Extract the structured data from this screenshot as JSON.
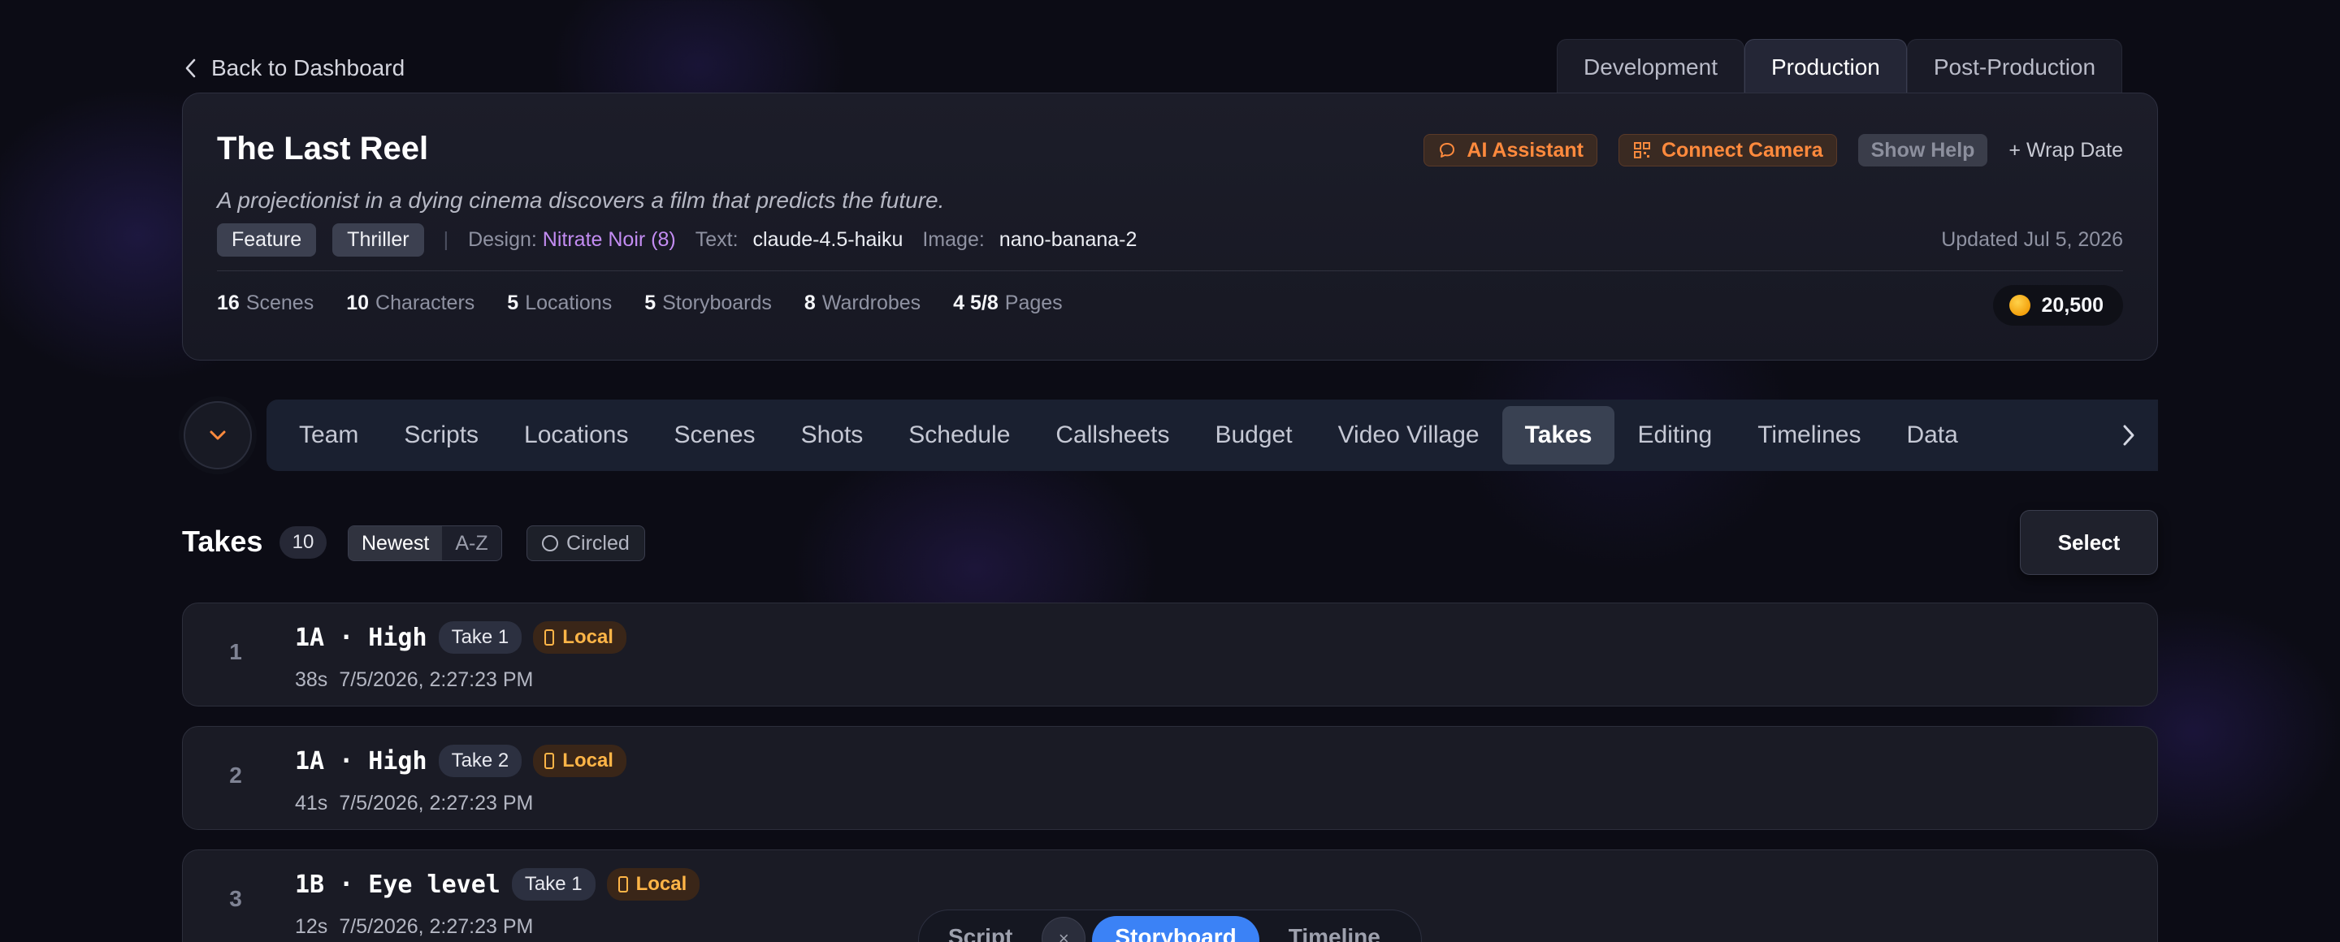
{
  "header": {
    "back_label": "Back to Dashboard",
    "phases": [
      {
        "label": "Development",
        "active": false
      },
      {
        "label": "Production",
        "active": true
      },
      {
        "label": "Post-Production",
        "active": false
      }
    ]
  },
  "project": {
    "title": "The Last Reel",
    "logline": "A projectionist in a dying cinema discovers a film that predicts the future.",
    "tags": [
      "Feature",
      "Thriller"
    ],
    "design_label": "Design:",
    "design_value": "Nitrate Noir (8)",
    "text_label": "Text:",
    "text_value": "claude-4.5-haiku",
    "image_label": "Image:",
    "image_value": "nano-banana-2",
    "updated": "Updated Jul 5, 2026",
    "actions": {
      "ai_assistant": "AI Assistant",
      "connect_camera": "Connect Camera",
      "show_help": "Show Help",
      "wrap_date": "+ Wrap Date"
    },
    "stats": [
      {
        "value": "16",
        "label": "Scenes"
      },
      {
        "value": "10",
        "label": "Characters"
      },
      {
        "value": "5",
        "label": "Locations"
      },
      {
        "value": "5",
        "label": "Storyboards"
      },
      {
        "value": "8",
        "label": "Wardrobes"
      },
      {
        "value": "4 5/8",
        "label": "Pages"
      }
    ],
    "credits": "20,500",
    "colors": {
      "accent_orange": "#ff8a3d",
      "design_purple": "#c38cf2",
      "coin": "#f3a10d"
    }
  },
  "nav": {
    "tabs": [
      "Team",
      "Scripts",
      "Locations",
      "Scenes",
      "Shots",
      "Schedule",
      "Callsheets",
      "Budget",
      "Video Village",
      "Takes",
      "Editing",
      "Timelines",
      "Data"
    ],
    "active": "Takes"
  },
  "takes": {
    "title": "Takes",
    "count": "10",
    "sort_newest": "Newest",
    "sort_az": "A-Z",
    "circled_label": "Circled",
    "select_label": "Select",
    "items": [
      {
        "num": "1",
        "shot": "1A · High",
        "take": "Take 1",
        "badge": "Local",
        "duration": "38s",
        "timestamp": "7/5/2026, 2:27:23 PM"
      },
      {
        "num": "2",
        "shot": "1A · High",
        "take": "Take 2",
        "badge": "Local",
        "duration": "41s",
        "timestamp": "7/5/2026, 2:27:23 PM"
      },
      {
        "num": "3",
        "shot": "1B · Eye level",
        "take": "Take 1",
        "badge": "Local",
        "duration": "12s",
        "timestamp": "7/5/2026, 2:27:23 PM"
      }
    ]
  },
  "view_switcher": {
    "script": "Script",
    "close": "×",
    "storyboard": "Storyboard",
    "timeline": "Timeline",
    "active": "Storyboard",
    "active_color": "#3b82f6"
  }
}
